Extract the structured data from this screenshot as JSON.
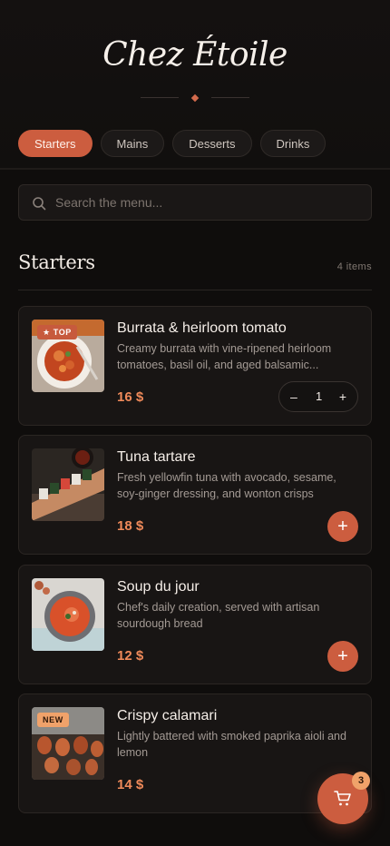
{
  "header": {
    "brand": "Chez Étoile"
  },
  "tabs": [
    {
      "label": "Starters",
      "active": true
    },
    {
      "label": "Mains",
      "active": false
    },
    {
      "label": "Desserts",
      "active": false
    },
    {
      "label": "Drinks",
      "active": false
    }
  ],
  "search": {
    "placeholder": "Search the menu...",
    "value": ""
  },
  "section": {
    "title": "Starters",
    "count": "4 items"
  },
  "items": [
    {
      "title": "Burrata & heirloom tomato",
      "desc": "Creamy burrata with vine-ripened heirloom tomatoes, basil oil, and aged balsamic...",
      "price": "16 $",
      "badge": "★ TOP",
      "quantity": "1",
      "stepper": {
        "minus": "–",
        "plus": "+"
      }
    },
    {
      "title": "Tuna tartare",
      "desc": "Fresh yellowfin tuna with avocado, sesame, soy-ginger dressing, and wonton crisps",
      "price": "18 $",
      "add": "+"
    },
    {
      "title": "Soup du jour",
      "desc": "Chef's daily creation, served with artisan sourdough bread",
      "price": "12 $",
      "add": "+"
    },
    {
      "title": "Crispy calamari",
      "desc": "Lightly battered with smoked paprika aioli and lemon",
      "price": "14 $",
      "badge": "NEW"
    }
  ],
  "cart": {
    "count": "3"
  },
  "colors": {
    "accent": "#cc5d3f",
    "price": "#f08a5a",
    "badge_new": "#f0a26a",
    "background": "#0f0d0c"
  }
}
